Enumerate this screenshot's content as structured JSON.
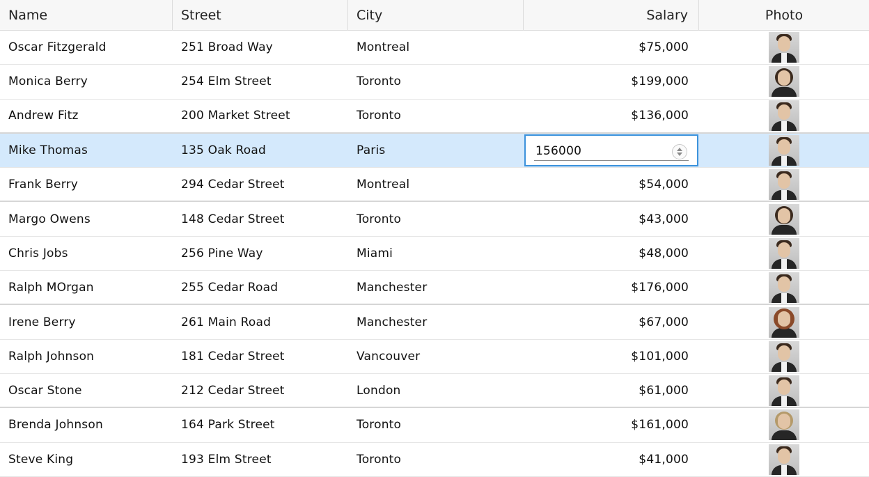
{
  "columns": {
    "name": "Name",
    "street": "Street",
    "city": "City",
    "salary": "Salary",
    "photo": "Photo"
  },
  "rows": [
    {
      "name": "Oscar Fitzgerald",
      "street": "251 Broad Way",
      "city": "Montreal",
      "salary": "$75,000",
      "photo": "person-photo-male"
    },
    {
      "name": "Monica Berry",
      "street": "254 Elm Street",
      "city": "Toronto",
      "salary": "$199,000",
      "photo": "person-photo-female"
    },
    {
      "name": "Andrew Fitz",
      "street": "200 Market Street",
      "city": "Toronto",
      "salary": "$136,000",
      "photo": "person-photo-male"
    },
    {
      "name": "Mike Thomas",
      "street": "135 Oak Road",
      "city": "Paris",
      "salary": "$156,000",
      "photo": "person-photo-male"
    },
    {
      "name": "Frank Berry",
      "street": "294 Cedar Street",
      "city": "Montreal",
      "salary": "$54,000",
      "photo": "person-photo-male"
    },
    {
      "name": "Margo Owens",
      "street": "148 Cedar Street",
      "city": "Toronto",
      "salary": "$43,000",
      "photo": "person-photo-female"
    },
    {
      "name": "Chris Jobs",
      "street": "256 Pine Way",
      "city": "Miami",
      "salary": "$48,000",
      "photo": "person-photo-male"
    },
    {
      "name": "Ralph MOrgan",
      "street": "255 Cedar Road",
      "city": "Manchester",
      "salary": "$176,000",
      "photo": "person-photo-male"
    },
    {
      "name": "Irene Berry",
      "street": "261 Main Road",
      "city": "Manchester",
      "salary": "$67,000",
      "photo": "person-photo-female"
    },
    {
      "name": "Ralph Johnson",
      "street": "181 Cedar Street",
      "city": "Vancouver",
      "salary": "$101,000",
      "photo": "person-photo-male"
    },
    {
      "name": "Oscar Stone",
      "street": "212 Cedar Street",
      "city": "London",
      "salary": "$61,000",
      "photo": "person-photo-male"
    },
    {
      "name": "Brenda Johnson",
      "street": "164 Park Street",
      "city": "Toronto",
      "salary": "$161,000",
      "photo": "person-photo-female"
    },
    {
      "name": "Steve King",
      "street": "193 Elm Street",
      "city": "Toronto",
      "salary": "$41,000",
      "photo": "person-photo-male"
    }
  ],
  "selected_row": 3,
  "editor": {
    "value": "156000",
    "icon": "spinner-icon"
  },
  "colors": {
    "selected_row_bg": "#d4e9fc",
    "editor_border": "#3c92db"
  }
}
